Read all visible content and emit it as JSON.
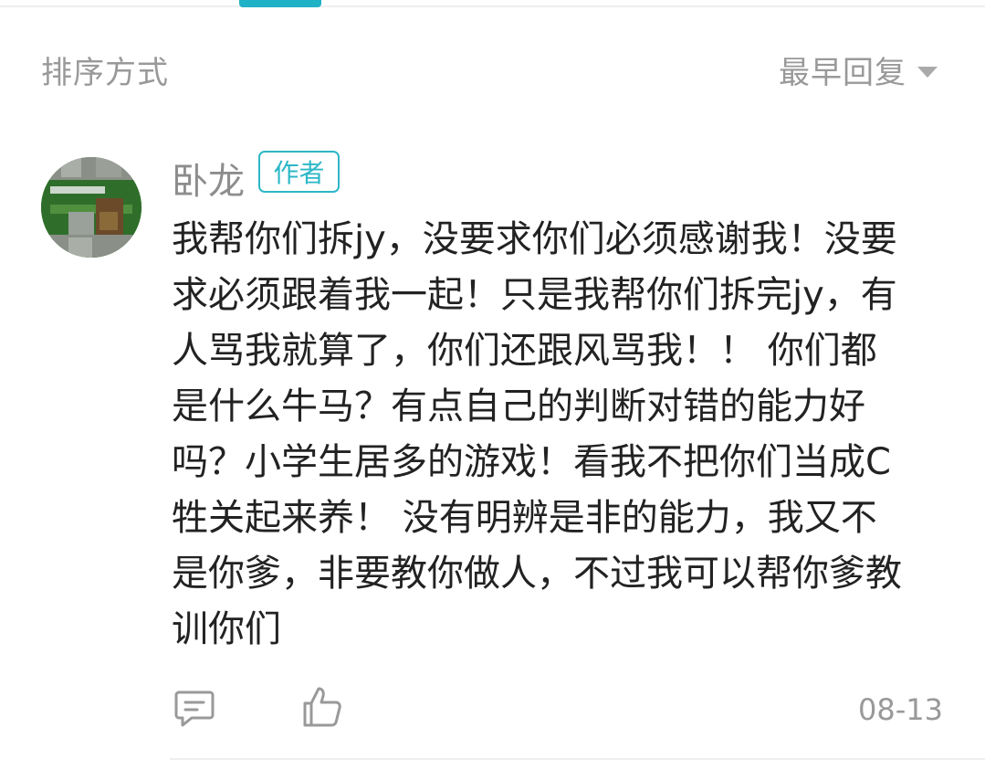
{
  "sort": {
    "label": "排序方式",
    "value": "最早回复"
  },
  "comment": {
    "author": "卧龙",
    "badge": "作者",
    "avatar_icon": "avatar-image",
    "text": "我帮你们拆jy，没要求你们必须感谢我！没要\n求必须跟着我一起！只是我帮你们拆完jy，有\n人骂我就算了，你们还跟风骂我！！ 你们都\n是什么牛马？有点自己的判断对错的能力好\n吗？小学生居多的游戏！看我不把你们当成C\n牲关起来养！ 没有明辨是非的能力，我又不\n是你爹，非要教你做人，不过我可以帮你爹教\n训你们",
    "date": "08-13",
    "reply_icon": "reply-icon",
    "like_icon": "thumbs-up-icon"
  },
  "colors": {
    "accent": "#1fb2c7",
    "badge": "#2cb7c7",
    "muted": "#999999",
    "text": "#222222"
  }
}
